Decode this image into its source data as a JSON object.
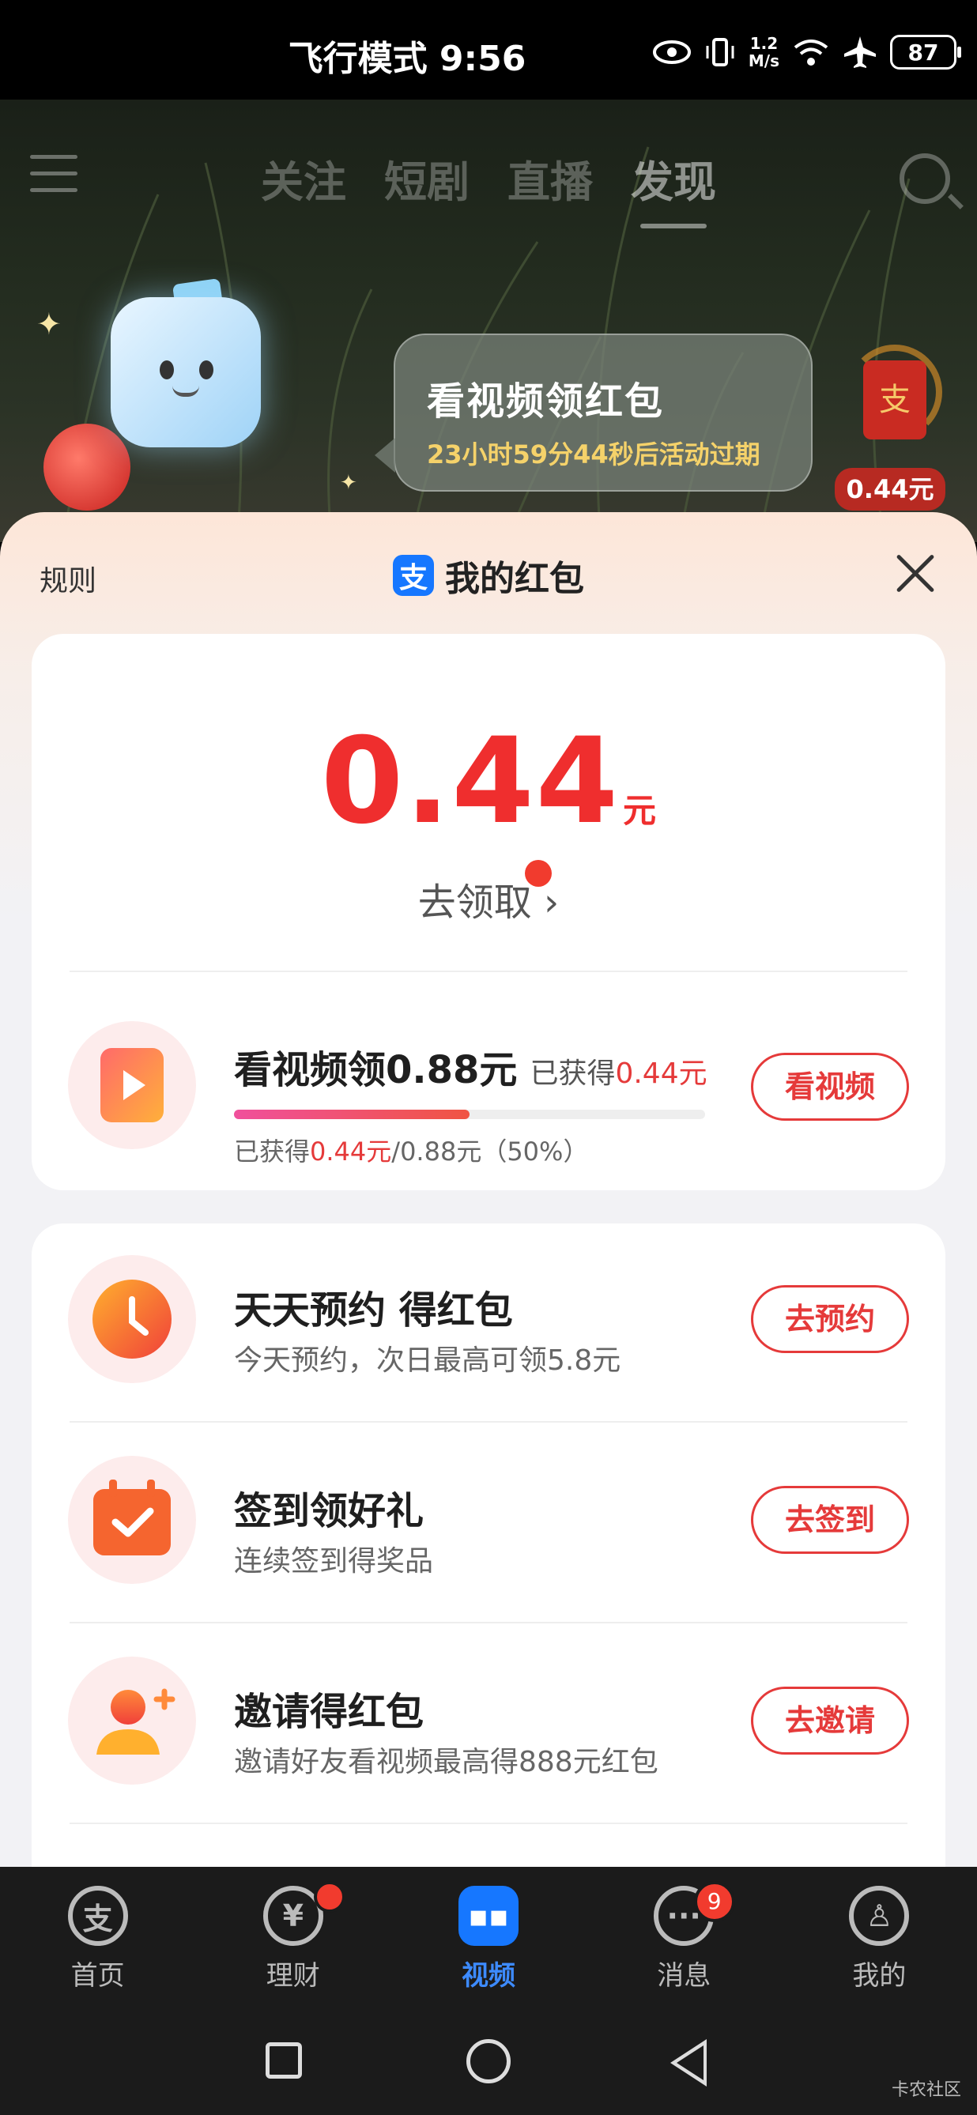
{
  "status_bar": {
    "time": "飞行模式 9:56",
    "speed_top": "1.2",
    "speed_bottom": "M/s",
    "battery": "87"
  },
  "top_nav": {
    "tabs": [
      "关注",
      "短剧",
      "直播",
      "发现"
    ],
    "active_tab": "发现"
  },
  "hero": {
    "title": "看视频领红包",
    "countdown": "23小时59分44秒后活动过期",
    "badge_amount": "0.44元",
    "badge_glyph": "支"
  },
  "sheet": {
    "rule_label": "规则",
    "title": "我的红包",
    "logo_glyph": "支"
  },
  "balance": {
    "amount": "0.44",
    "unit": "元",
    "claim_label": "去领取"
  },
  "watch_task": {
    "title": "看视频领0.88元",
    "earned_prefix": "已获得",
    "earned_value": "0.44元",
    "progress_prefix": "已获得",
    "progress_value": "0.44元",
    "progress_suffix": "/0.88元（50%）",
    "progress": 0.5,
    "button": "看视频"
  },
  "tasks": [
    {
      "title": "天天预约 得红包",
      "subtitle": "今天预约，次日最高可领5.8元",
      "button": "去预约",
      "icon": "clock-icon"
    },
    {
      "title": "签到领好礼",
      "subtitle": "连续签到得奖品",
      "button": "去签到",
      "icon": "calendar-check-icon"
    },
    {
      "title": "邀请得红包",
      "subtitle": "邀请好友看视频最高得888元红包",
      "button": "去邀请",
      "icon": "invite-user-icon"
    }
  ],
  "bottom_nav": {
    "items": [
      {
        "label": "首页",
        "glyph": "支"
      },
      {
        "label": "理财",
        "glyph": "¥"
      },
      {
        "label": "视频",
        "glyph": "▪▪"
      },
      {
        "label": "消息",
        "glyph": "···"
      },
      {
        "label": "我的",
        "glyph": "♙"
      }
    ],
    "message_badge": "9"
  },
  "watermark": "卡农社区",
  "colors": {
    "accent_red": "#e53a3a",
    "alipay_blue": "#1677ff",
    "amount_red": "#ef2e2e"
  }
}
